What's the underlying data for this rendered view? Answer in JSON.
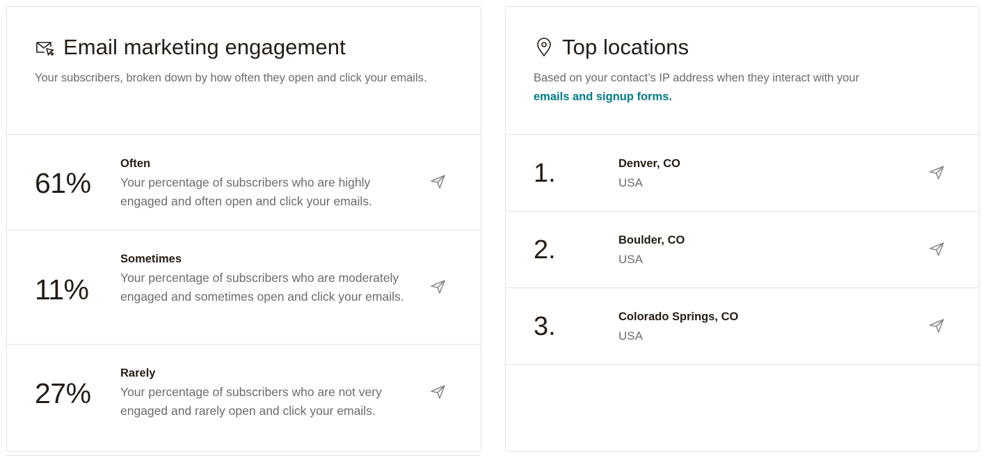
{
  "engagement": {
    "title": "Email marketing engagement",
    "description": "Your subscribers, broken down by how often they open and click your emails.",
    "rows": [
      {
        "percent": "61%",
        "label": "Often",
        "text": "Your percentage of subscribers who are highly engaged and often open and click your emails."
      },
      {
        "percent": "11%",
        "label": "Sometimes",
        "text": "Your percentage of subscribers who are moderately engaged and sometimes open and click your emails."
      },
      {
        "percent": "27%",
        "label": "Rarely",
        "text": "Your percentage of subscribers who are not very engaged and rarely open and click your emails."
      }
    ]
  },
  "locations": {
    "title": "Top locations",
    "description": "Based on your contact’s IP address when they interact with your",
    "link_text": "emails and signup forms.",
    "rows": [
      {
        "rank": "1.",
        "city": "Denver, CO",
        "country": "USA"
      },
      {
        "rank": "2.",
        "city": "Boulder, CO",
        "country": "USA"
      },
      {
        "rank": "3.",
        "city": "Colorado Springs, CO",
        "country": "USA"
      }
    ]
  },
  "icons": {
    "engagement_title": "mail-cursor-icon",
    "locations_title": "map-pin-icon",
    "row_action": "send-icon"
  },
  "colors": {
    "link": "#007c89",
    "text": "#241c15",
    "muted": "#6b6b6b",
    "border": "#e2e2e2"
  }
}
